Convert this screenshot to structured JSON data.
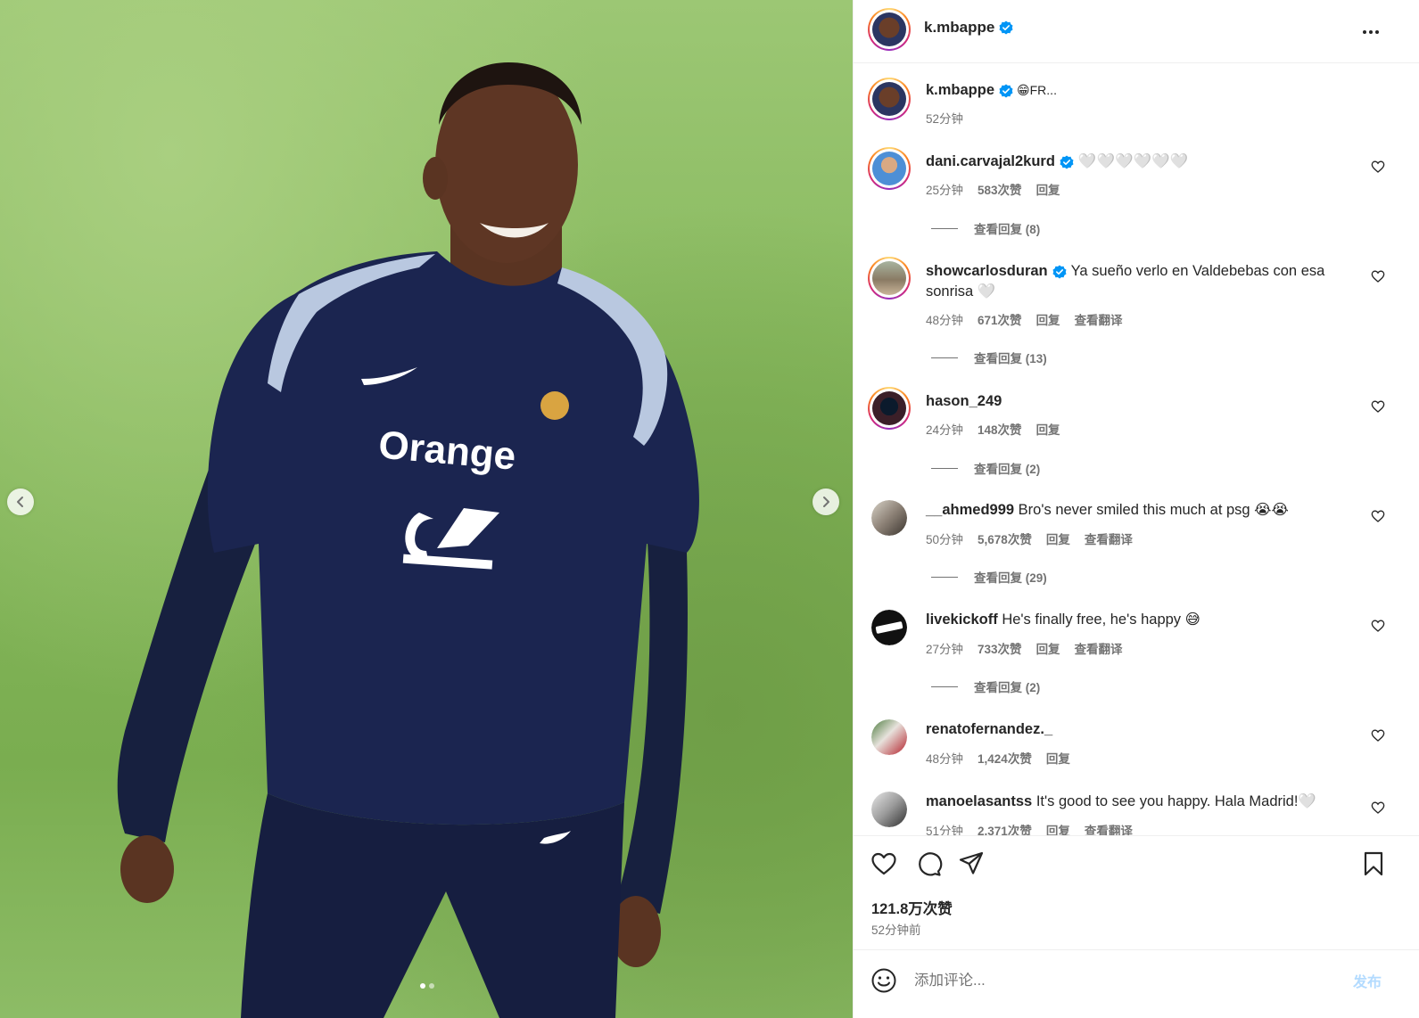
{
  "post": {
    "author": "k.mbappe",
    "caption_snippet": "😁FR...",
    "caption_time": "52分钟",
    "likes": "121.8万次赞",
    "posted": "52分钟前"
  },
  "comments": [
    {
      "user": "dani.carvajal2kurd",
      "verified": true,
      "text": "🤍🤍🤍🤍🤍🤍",
      "time": "25分钟",
      "likes": "583次赞",
      "reply": "回复",
      "translate": "",
      "replies": "查看回复 (8)"
    },
    {
      "user": "showcarlosduran",
      "verified": true,
      "text": "Ya sueño verlo en Valdebebas con esa sonrisa 🤍",
      "time": "48分钟",
      "likes": "671次赞",
      "reply": "回复",
      "translate": "查看翻译",
      "replies": "查看回复 (13)"
    },
    {
      "user": "hason_249",
      "verified": false,
      "text": "",
      "time": "24分钟",
      "likes": "148次赞",
      "reply": "回复",
      "translate": "",
      "replies": "查看回复 (2)"
    },
    {
      "user": "__ahmed999",
      "verified": false,
      "text": "Bro's never smiled this much at psg 😭😭",
      "time": "50分钟",
      "likes": "5,678次赞",
      "reply": "回复",
      "translate": "查看翻译",
      "replies": "查看回复 (29)"
    },
    {
      "user": "livekickoff",
      "verified": false,
      "text": "He's finally free, he's happy 😅",
      "time": "27分钟",
      "likes": "733次赞",
      "reply": "回复",
      "translate": "查看翻译",
      "replies": "查看回复 (2)"
    },
    {
      "user": "renatofernandez._",
      "verified": false,
      "text": "",
      "time": "48分钟",
      "likes": "1,424次赞",
      "reply": "回复",
      "translate": "",
      "replies": ""
    },
    {
      "user": "manoelasantss",
      "verified": false,
      "text": "It's good to see you happy. Hala Madrid!🤍",
      "time": "51分钟",
      "likes": "2,371次赞",
      "reply": "回复",
      "translate": "查看翻译",
      "replies": ""
    }
  ],
  "input": {
    "placeholder": "添加评论...",
    "post_label": "发布"
  },
  "icons": {
    "more": "more-horizontal-icon",
    "verified": "verified-badge-icon",
    "like": "heart-icon",
    "comment": "comment-icon",
    "share": "send-icon",
    "save": "bookmark-icon",
    "emoji": "emoji-icon",
    "prev": "chevron-left-icon",
    "next": "chevron-right-icon"
  },
  "colors": {
    "verified": "#0095f6",
    "text": "#262626",
    "muted": "#737373",
    "post_button": "#b3dbff"
  }
}
